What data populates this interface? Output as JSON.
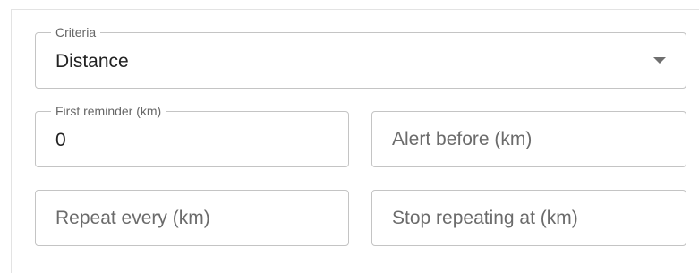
{
  "form": {
    "criteria": {
      "label": "Criteria",
      "value": "Distance"
    },
    "first_reminder": {
      "label": "First reminder (km)",
      "value": "0"
    },
    "alert_before": {
      "placeholder": "Alert before (km)"
    },
    "repeat_every": {
      "placeholder": "Repeat every (km)"
    },
    "stop_repeating_at": {
      "placeholder": "Stop repeating at (km)"
    }
  },
  "icons": {
    "criteria_dropdown": "chevron-down-icon"
  },
  "colors": {
    "border": "#c4c4c4",
    "label": "#666666",
    "text": "#222222",
    "placeholder": "#6b6b6b"
  }
}
